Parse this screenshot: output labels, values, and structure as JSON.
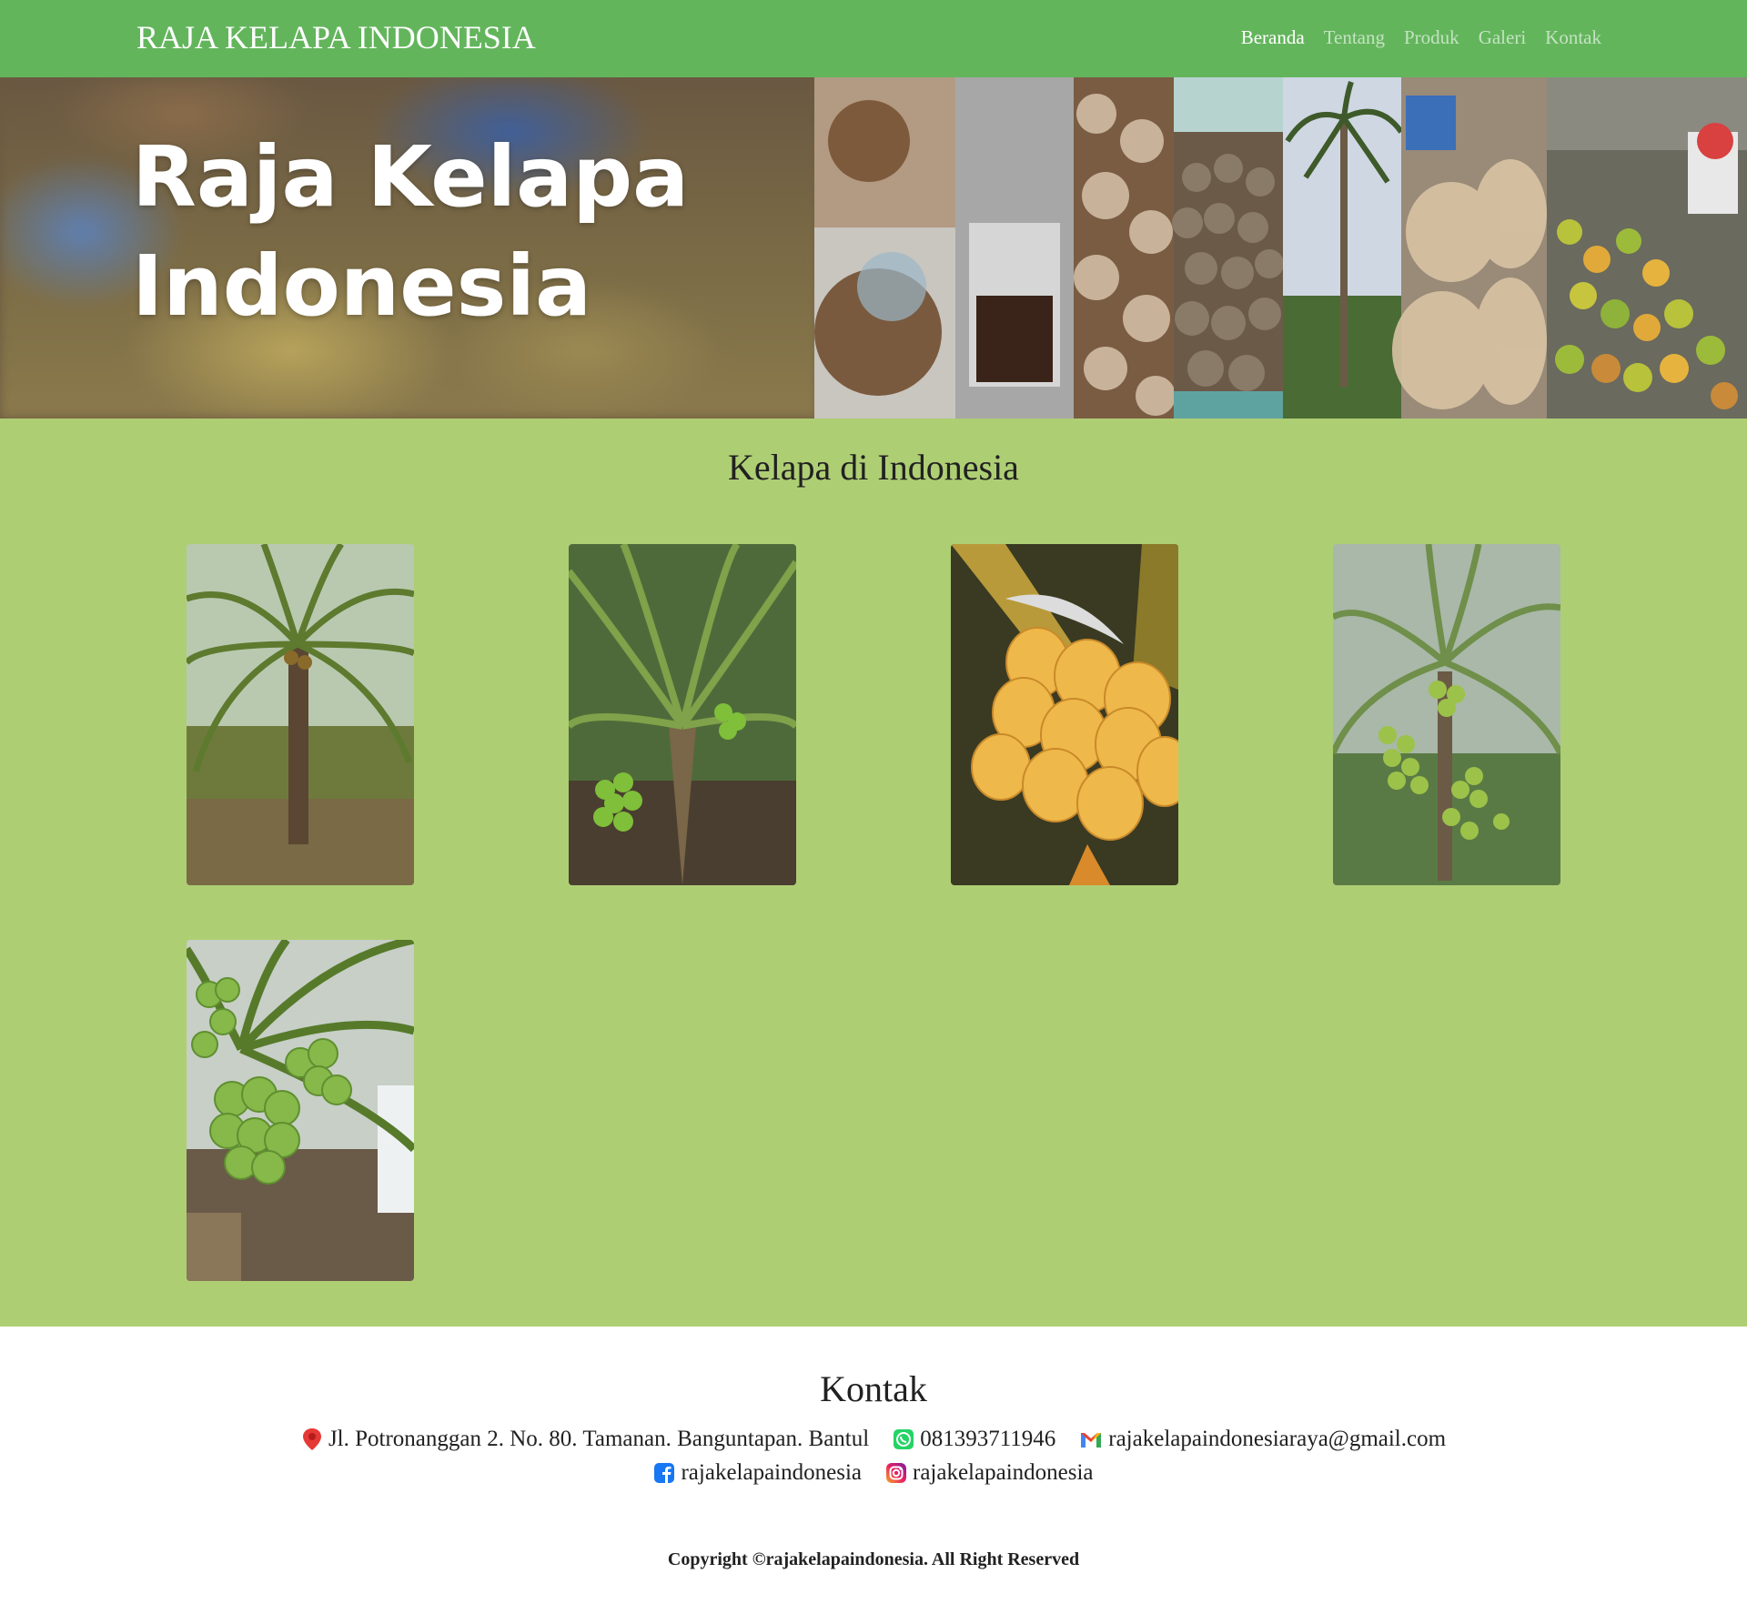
{
  "navbar": {
    "brand": "RAJA KELAPA INDONESIA",
    "links": [
      "Beranda",
      "Tentang",
      "Produk",
      "Galeri",
      "Kontak"
    ],
    "active": "Beranda",
    "background": "#63b55c"
  },
  "hero": {
    "title": "Raja Kelapa Indonesia"
  },
  "gallery": {
    "title": "Kelapa di Indonesia",
    "background": "#aece74",
    "photos": [
      {
        "name": "coconut-palm-tree-photo-1"
      },
      {
        "name": "coconut-palm-tree-photo-2"
      },
      {
        "name": "yellow-coconut-bunch-photo"
      },
      {
        "name": "coconut-palm-tree-photo-3"
      },
      {
        "name": "green-coconut-bunch-photo"
      }
    ]
  },
  "footer": {
    "title": "Kontak",
    "address": "Jl. Potronanggan 2. No. 80. Tamanan. Banguntapan. Bantul",
    "phone": "081393711946",
    "email": "rajakelapaindonesiaraya@gmail.com",
    "facebook": "rajakelapaindonesia",
    "instagram": "rajakelapaindonesia",
    "copyright": "Copyright ©rajakelapaindonesia. All Right Reserved"
  },
  "icons": {
    "address": "map-pin-icon",
    "phone": "whatsapp-icon",
    "email": "gmail-icon",
    "facebook": "facebook-icon",
    "instagram": "instagram-icon"
  }
}
